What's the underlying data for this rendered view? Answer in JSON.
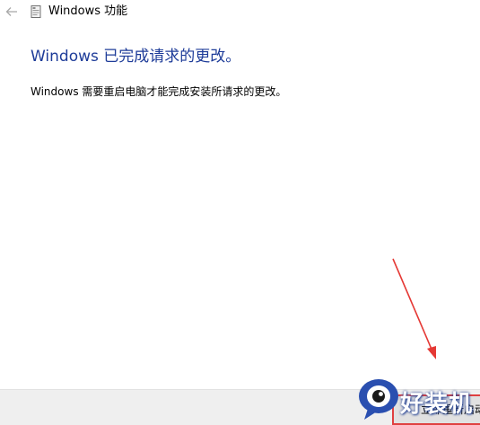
{
  "window": {
    "title": "Windows 功能",
    "back_icon": "back-arrow-icon",
    "app_icon": "windows-features-icon"
  },
  "content": {
    "heading": "Windows 已完成请求的更改。",
    "message": "Windows 需要重启电脑才能完成安装所请求的更改。"
  },
  "footer": {
    "restart_label": "立即重新启动"
  },
  "watermark": {
    "text": "好装机"
  },
  "colors": {
    "heading": "#1e3c99",
    "annotation": "#e53935",
    "footer_bg": "#efefef"
  }
}
